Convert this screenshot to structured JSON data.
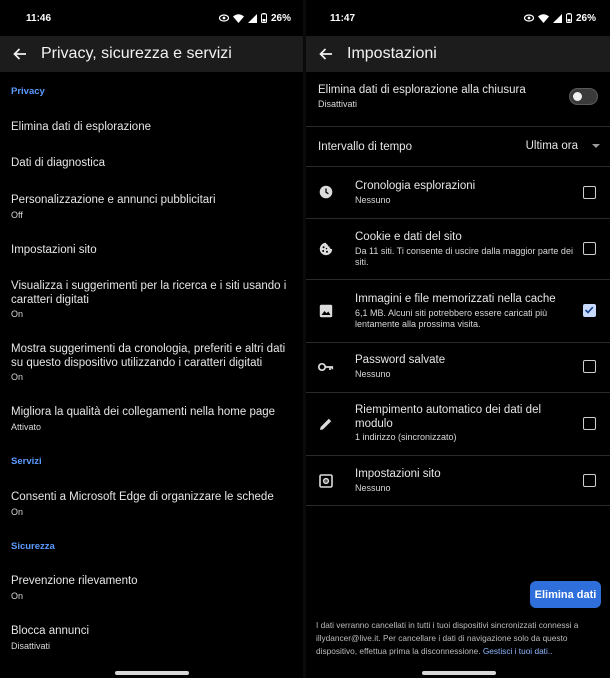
{
  "left": {
    "status": {
      "time": "11:46",
      "battery": "26%"
    },
    "title": "Privacy, sicurezza e servizi",
    "sections": [
      {
        "header": "Privacy"
      },
      {
        "header": "Servizi"
      },
      {
        "header": "Sicurezza"
      }
    ],
    "items": [
      {
        "title": "Elimina dati di esplorazione",
        "sub": ""
      },
      {
        "title": "Dati di diagnostica",
        "sub": ""
      },
      {
        "title": "Personalizzazione e annunci pubblicitari",
        "sub": "Off"
      },
      {
        "title": "Impostazioni sito",
        "sub": ""
      },
      {
        "title": "Visualizza i suggerimenti per la ricerca e i siti usando i caratteri digitati",
        "sub": "On"
      },
      {
        "title": "Mostra suggerimenti da cronologia, preferiti e altri dati su questo dispositivo utilizzando i caratteri digitati",
        "sub": "On"
      },
      {
        "title": "Migliora la qualità dei collegamenti nella home page",
        "sub": "Attivato"
      },
      {
        "title": "Consenti a Microsoft Edge di organizzare le schede",
        "sub": "On"
      },
      {
        "title": "Prevenzione rilevamento",
        "sub": "On"
      },
      {
        "title": "Blocca annunci",
        "sub": "Disattivati"
      }
    ]
  },
  "right": {
    "status": {
      "time": "11:47",
      "battery": "26%"
    },
    "title": "Impostazioni",
    "toggle": {
      "title": "Elimina dati di esplorazione alla chiusura",
      "sub": "Disattivati",
      "on": false
    },
    "interval": {
      "label": "Intervallo di tempo",
      "value": "Ultima ora"
    },
    "items": [
      {
        "icon": "clock-icon",
        "title": "Cronologia esplorazioni",
        "sub": "Nessuno",
        "checked": false
      },
      {
        "icon": "cookie-icon",
        "title": "Cookie e dati del sito",
        "sub": "Da 11 siti. Ti consente di uscire dalla maggior parte dei siti.",
        "checked": false
      },
      {
        "icon": "image-icon",
        "title": "Immagini e file memorizzati nella cache",
        "sub": "6,1 MB. Alcuni siti potrebbero essere caricati più lentamente alla prossima visita.",
        "checked": true
      },
      {
        "icon": "key-icon",
        "title": "Password salvate",
        "sub": "Nessuno",
        "checked": false
      },
      {
        "icon": "pencil-icon",
        "title": "Riempimento automatico dei dati del modulo",
        "sub": "1 indirizzo (sincronizzato)",
        "checked": false
      },
      {
        "icon": "site-settings-icon",
        "title": "Impostazioni sito",
        "sub": "Nessuno",
        "checked": false
      }
    ],
    "button": "Elimina dati",
    "footer": "I dati verranno cancellati in tutti i tuoi dispositivi sincronizzati connessi a illydancer@live.it. Per cancellare i dati di navigazione solo da questo dispositivo, effettua prima la disconnessione.",
    "footer_link": "Gestisci i tuoi dati.."
  }
}
